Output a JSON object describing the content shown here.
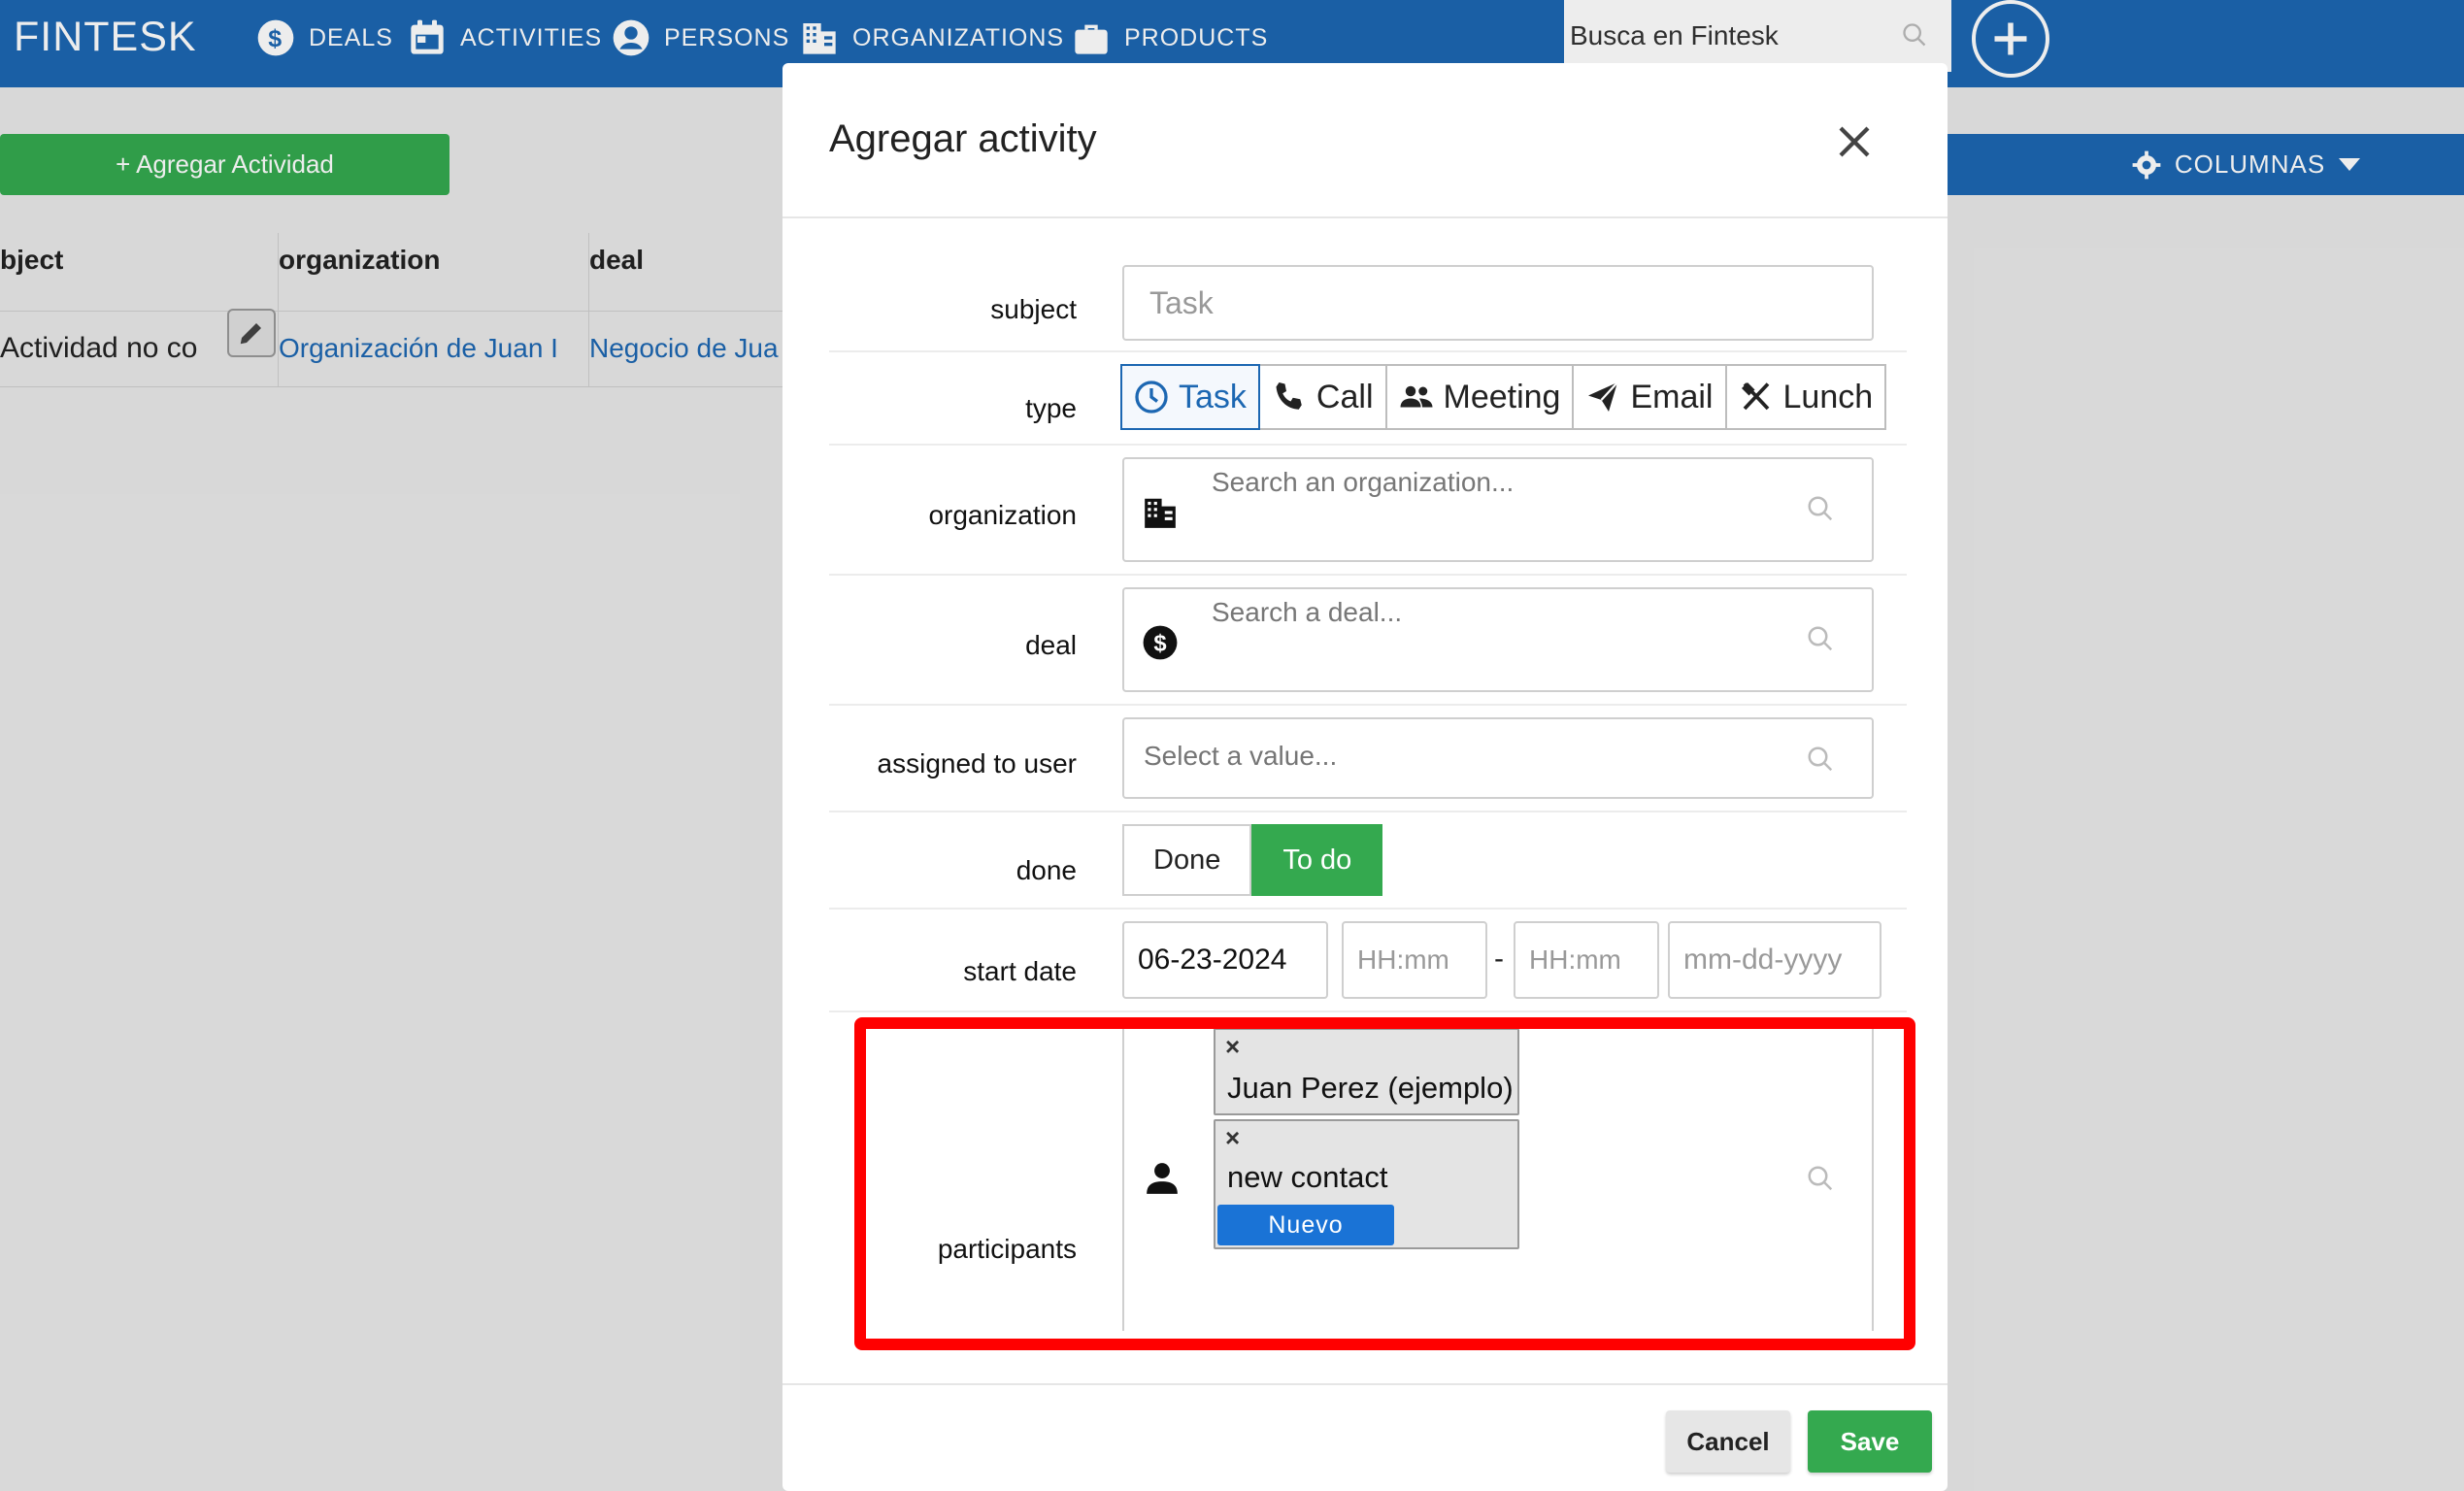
{
  "navbar": {
    "brand": "FINTESK",
    "items": [
      {
        "label": "DEALS",
        "icon": "dollar-circle-icon"
      },
      {
        "label": "ACTIVITIES",
        "icon": "calendar-icon"
      },
      {
        "label": "PERSONS",
        "icon": "user-circle-icon"
      },
      {
        "label": "ORGANIZATIONS",
        "icon": "building-icon"
      },
      {
        "label": "PRODUCTS",
        "icon": "briefcase-icon"
      }
    ],
    "search_placeholder": "Busca en Fintesk",
    "add_icon": "plus-circle-icon"
  },
  "page": {
    "add_activity_label": "+ Agregar Actividad",
    "columns_label": "COLUMNAS",
    "table": {
      "headers": [
        "bject",
        "organization",
        "deal"
      ],
      "row": {
        "subject": "Actividad no co",
        "organization": "Organización de Juan I",
        "deal": "Negocio de Jua"
      }
    }
  },
  "modal": {
    "title": "Agregar activity",
    "subject": {
      "label": "subject",
      "placeholder": "Task"
    },
    "type": {
      "label": "type",
      "options": [
        {
          "label": "Task",
          "icon": "clock-icon",
          "active": true
        },
        {
          "label": "Call",
          "icon": "phone-icon",
          "active": false
        },
        {
          "label": "Meeting",
          "icon": "people-icon",
          "active": false
        },
        {
          "label": "Email",
          "icon": "send-icon",
          "active": false
        },
        {
          "label": "Lunch",
          "icon": "utensils-icon",
          "active": false
        }
      ]
    },
    "organization": {
      "label": "organization",
      "placeholder": "Search an organization..."
    },
    "deal": {
      "label": "deal",
      "placeholder": "Search a deal..."
    },
    "assigned_user": {
      "label": "assigned to user",
      "placeholder": "Select a value..."
    },
    "done": {
      "label": "done",
      "options": [
        "Done",
        "To do"
      ],
      "selected": "To do"
    },
    "start_date": {
      "label": "start date",
      "date": "06-23-2024",
      "time_start_placeholder": "HH:mm",
      "separator": "-",
      "time_end_placeholder": "HH:mm",
      "end_date_placeholder": "mm-dd-yyyy"
    },
    "participants": {
      "label": "participants",
      "chips": [
        {
          "name": "Juan Perez (ejemplo)",
          "remove": "×"
        },
        {
          "name": "new contact",
          "remove": "×",
          "badge": "Nuevo"
        }
      ]
    },
    "cancel_label": "Cancel",
    "save_label": "Save"
  },
  "colors": {
    "primary": "#1c67b2",
    "success": "#34a94f",
    "highlight": "#ff0000",
    "badge": "#1a73d6"
  }
}
